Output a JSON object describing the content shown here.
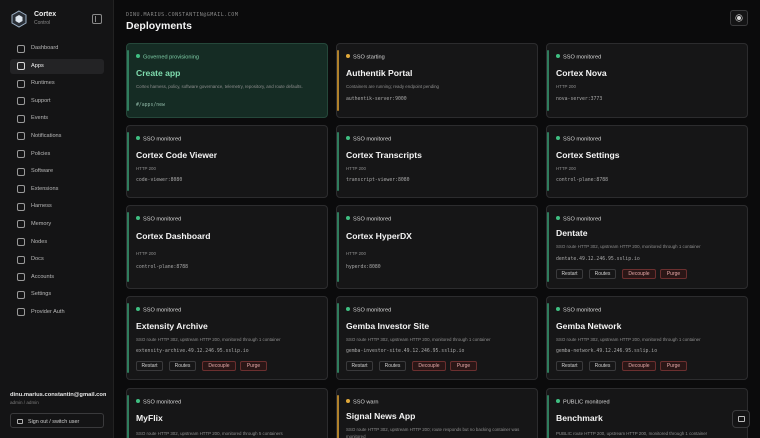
{
  "brand": {
    "name": "Cortex",
    "subtitle": "Control"
  },
  "nav": [
    {
      "label": "Dashboard",
      "icon": "pulse-icon",
      "active": false
    },
    {
      "label": "Apps",
      "icon": "grid-icon",
      "active": true
    },
    {
      "label": "Runtimes",
      "icon": "cube-icon",
      "active": false
    },
    {
      "label": "Support",
      "icon": "lifebuoy-icon",
      "active": false
    },
    {
      "label": "Events",
      "icon": "list-icon",
      "active": false
    },
    {
      "label": "Notifications",
      "icon": "bell-icon",
      "active": false
    },
    {
      "label": "Policies",
      "icon": "shield-icon",
      "active": false
    },
    {
      "label": "Software",
      "icon": "package-icon",
      "active": false
    },
    {
      "label": "Extensions",
      "icon": "puzzle-icon",
      "active": false
    },
    {
      "label": "Harness",
      "icon": "shield-check-icon",
      "active": false
    },
    {
      "label": "Memory",
      "icon": "info-icon",
      "active": false
    },
    {
      "label": "Nodes",
      "icon": "network-icon",
      "active": false
    },
    {
      "label": "Docs",
      "icon": "book-icon",
      "active": false
    },
    {
      "label": "Accounts",
      "icon": "users-icon",
      "active": false
    },
    {
      "label": "Settings",
      "icon": "sliders-icon",
      "active": false
    },
    {
      "label": "Provider Auth",
      "icon": "key-icon",
      "active": false
    }
  ],
  "user": {
    "name": "dinu.marius.constantin@gmail.com",
    "role": "admin / admin",
    "signout_label": "Sign out / switch user"
  },
  "header": {
    "email": "DINU.MARIUS.CONSTANTIN@GMAIL.COM",
    "title": "Deployments"
  },
  "buttons": {
    "restart": "Restart",
    "routes": "Routes",
    "decouple": "Decouple",
    "purge": "Purge"
  },
  "cards": [
    {
      "status": "Governed provisioning",
      "name": "Create app",
      "desc": "Cortex harness, policy, software governance, telemetry, repository, and route defaults.",
      "mono": "#/apps/new"
    },
    {
      "status": "SSO starting",
      "name": "Authentik Portal",
      "desc": "Containers are running; ready endpoint pending",
      "mono": "authentik-server:9000"
    },
    {
      "status": "SSO monitored",
      "name": "Cortex Nova",
      "desc": "HTTP 200",
      "mono": "nova-server:3773"
    },
    {
      "status": "SSO monitored",
      "name": "Cortex Code Viewer",
      "desc": "HTTP 200",
      "mono": "code-viewer:8080"
    },
    {
      "status": "SSO monitored",
      "name": "Cortex Transcripts",
      "desc": "HTTP 200",
      "mono": "transcript-viewer:8080"
    },
    {
      "status": "SSO monitored",
      "name": "Cortex Settings",
      "desc": "HTTP 200",
      "mono": "control-plane:8788"
    },
    {
      "status": "SSO monitored",
      "name": "Cortex Dashboard",
      "desc": "HTTP 200",
      "mono": "control-plane:8788"
    },
    {
      "status": "SSO monitored",
      "name": "Cortex HyperDX",
      "desc": "HTTP 200",
      "mono": "hyperdx:8080"
    },
    {
      "status": "SSO monitored",
      "name": "Dentate",
      "desc": "SSO route HTTP 302, upstream HTTP 200, monitored through 1 container",
      "mono": "dentate.49.12.246.95.sslip.io"
    },
    {
      "status": "SSO monitored",
      "name": "Extensity Archive",
      "desc": "SSO route HTTP 302, upstream HTTP 200, monitored through 1 container",
      "mono": "extensity-archive.49.12.246.95.sslip.io"
    },
    {
      "status": "SSO monitored",
      "name": "Gemba Investor Site",
      "desc": "SSO route HTTP 302, upstream HTTP 200, monitored through 1 container",
      "mono": "gemba-investor-site.49.12.246.95.sslip.io"
    },
    {
      "status": "SSO monitored",
      "name": "Gemba Network",
      "desc": "SSO route HTTP 302, upstream HTTP 200, monitored through 1 container",
      "mono": "gemba-network.49.12.246.95.sslip.io"
    },
    {
      "status": "SSO monitored",
      "name": "MyFlix",
      "desc": "SSO route HTTP 302, upstream HTTP 200, monitored through 5 containers",
      "mono": ""
    },
    {
      "status": "SSO warn",
      "name": "Signal News App",
      "desc": "SSO route HTTP 302, upstream HTTP 200; route responds but no backing container was monitored",
      "mono": ""
    },
    {
      "status": "PUBLIC monitored",
      "name": "Benchmark",
      "desc": "PUBLIC route HTTP 200, upstream HTTP 200, monitored through 1 container",
      "mono": ""
    }
  ],
  "colors": {
    "accent_green": "#3fbf82",
    "warn_amber": "#e0a83a",
    "danger": "#e6a8a8"
  }
}
